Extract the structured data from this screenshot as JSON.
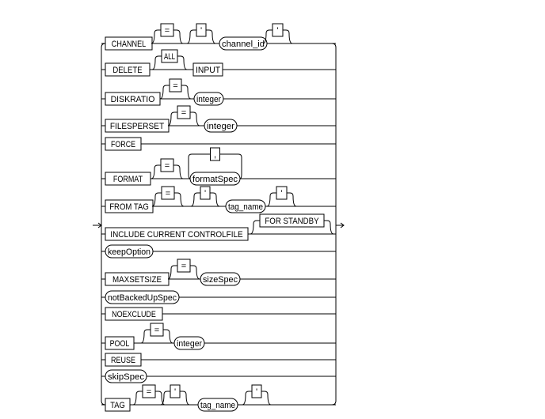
{
  "diagram": {
    "type": "railroad-syntax",
    "rows": [
      {
        "items": [
          {
            "kind": "keyword",
            "text": "CHANNEL"
          },
          {
            "kind": "keyword",
            "text": "=",
            "optional": true
          },
          {
            "kind": "keyword",
            "text": "'",
            "optional": true
          },
          {
            "kind": "nonterminal",
            "text": "channel_id"
          },
          {
            "kind": "keyword",
            "text": "'",
            "optional": true
          }
        ]
      },
      {
        "items": [
          {
            "kind": "keyword",
            "text": "DELETE"
          },
          {
            "kind": "keyword",
            "text": "ALL",
            "optional": true
          },
          {
            "kind": "keyword",
            "text": "INPUT"
          }
        ]
      },
      {
        "items": [
          {
            "kind": "keyword",
            "text": "DISKRATIO"
          },
          {
            "kind": "keyword",
            "text": "=",
            "optional": true
          },
          {
            "kind": "nonterminal",
            "text": "integer"
          }
        ]
      },
      {
        "items": [
          {
            "kind": "keyword",
            "text": "FILESPERSET"
          },
          {
            "kind": "keyword",
            "text": "=",
            "optional": true
          },
          {
            "kind": "nonterminal",
            "text": "integer"
          }
        ]
      },
      {
        "items": [
          {
            "kind": "keyword",
            "text": "FORCE"
          }
        ]
      },
      {
        "items": [
          {
            "kind": "keyword",
            "text": "FORMAT"
          },
          {
            "kind": "keyword",
            "text": "=",
            "optional": true
          },
          {
            "kind": "nonterminal",
            "text": "formatSpec",
            "repeat_separator": ","
          }
        ]
      },
      {
        "items": [
          {
            "kind": "keyword",
            "text": "FROM TAG"
          },
          {
            "kind": "keyword",
            "text": "=",
            "optional": true
          },
          {
            "kind": "keyword",
            "text": "'",
            "optional": true
          },
          {
            "kind": "nonterminal",
            "text": "tag_name"
          },
          {
            "kind": "keyword",
            "text": "'",
            "optional": true
          }
        ]
      },
      {
        "items": [
          {
            "kind": "keyword",
            "text": "INCLUDE CURRENT CONTROLFILE"
          },
          {
            "kind": "keyword",
            "text": "FOR STANDBY",
            "optional": true
          }
        ]
      },
      {
        "items": [
          {
            "kind": "nonterminal",
            "text": "keepOption"
          }
        ]
      },
      {
        "items": [
          {
            "kind": "keyword",
            "text": "MAXSETSIZE"
          },
          {
            "kind": "keyword",
            "text": "=",
            "optional": true
          },
          {
            "kind": "nonterminal",
            "text": "sizeSpec"
          }
        ]
      },
      {
        "items": [
          {
            "kind": "nonterminal",
            "text": "notBackedUpSpec"
          }
        ]
      },
      {
        "items": [
          {
            "kind": "keyword",
            "text": "NOEXCLUDE"
          }
        ]
      },
      {
        "items": [
          {
            "kind": "keyword",
            "text": "POOL"
          },
          {
            "kind": "keyword",
            "text": "=",
            "optional": true
          },
          {
            "kind": "nonterminal",
            "text": "integer"
          }
        ]
      },
      {
        "items": [
          {
            "kind": "keyword",
            "text": "REUSE"
          }
        ]
      },
      {
        "items": [
          {
            "kind": "nonterminal",
            "text": "skipSpec"
          }
        ]
      },
      {
        "items": [
          {
            "kind": "keyword",
            "text": "TAG"
          },
          {
            "kind": "keyword",
            "text": "=",
            "optional": true
          },
          {
            "kind": "keyword",
            "text": "'",
            "optional": true
          },
          {
            "kind": "nonterminal",
            "text": "tag_name"
          },
          {
            "kind": "keyword",
            "text": "'",
            "optional": true
          }
        ]
      }
    ]
  }
}
